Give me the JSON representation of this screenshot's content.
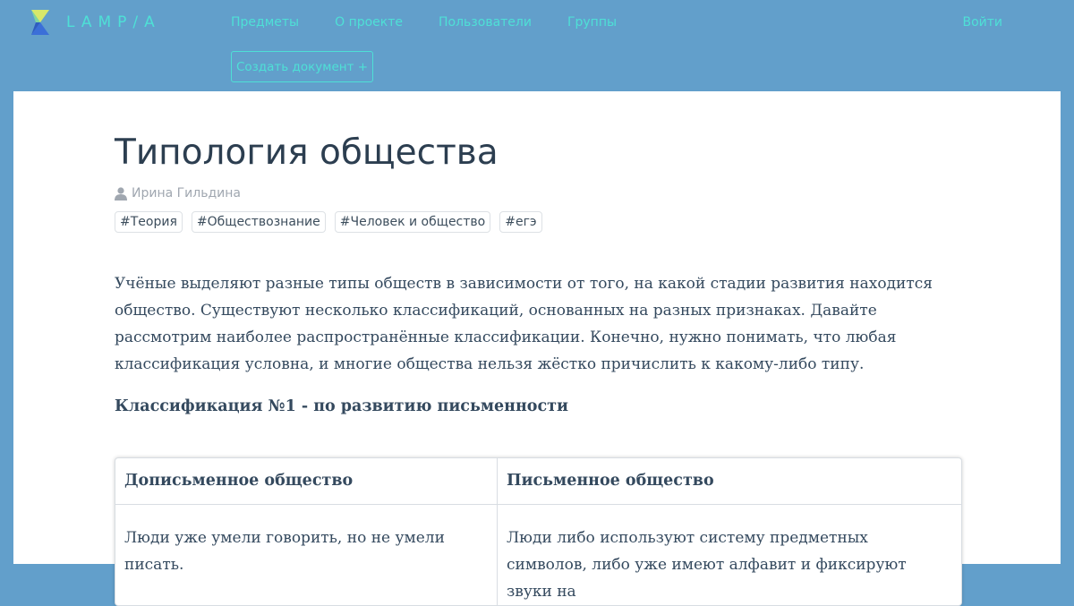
{
  "header": {
    "logo_text": "LAMP/A",
    "nav": [
      "Предметы",
      "О проекте",
      "Пользователи",
      "Группы"
    ],
    "login_label": "Войти",
    "create_button_label": "Создать документ +"
  },
  "article": {
    "title": "Типология общества",
    "author": "Ирина Гильдина",
    "tags": [
      "#Теория",
      "#Обществознание",
      "#Человек и общество",
      "#егэ"
    ],
    "intro": "Учёные выделяют разные типы обществ в зависимости от того, на какой стадии развития находится общество. Существуют несколько классификаций, основанных на разных признаках. Давайте рассмотрим наиболее распространённые классификации. Конечно, нужно понимать, что любая классификация условна, и многие общества нельзя жёстко причислить к какому-либо типу.",
    "subheading": "Классификация №1 - по развитию письменности",
    "table": {
      "headers": [
        "Дописьменное общество",
        "Письменное общество"
      ],
      "rows": [
        [
          "Люди уже умели говорить, но не умели писать.",
          "Люди либо используют систему предметных символов, либо уже имеют алфавит и фиксируют звуки на"
        ]
      ]
    }
  },
  "colors": {
    "header_bg": "#629fcb",
    "accent": "#4ee0d6",
    "text": "#34495e"
  }
}
